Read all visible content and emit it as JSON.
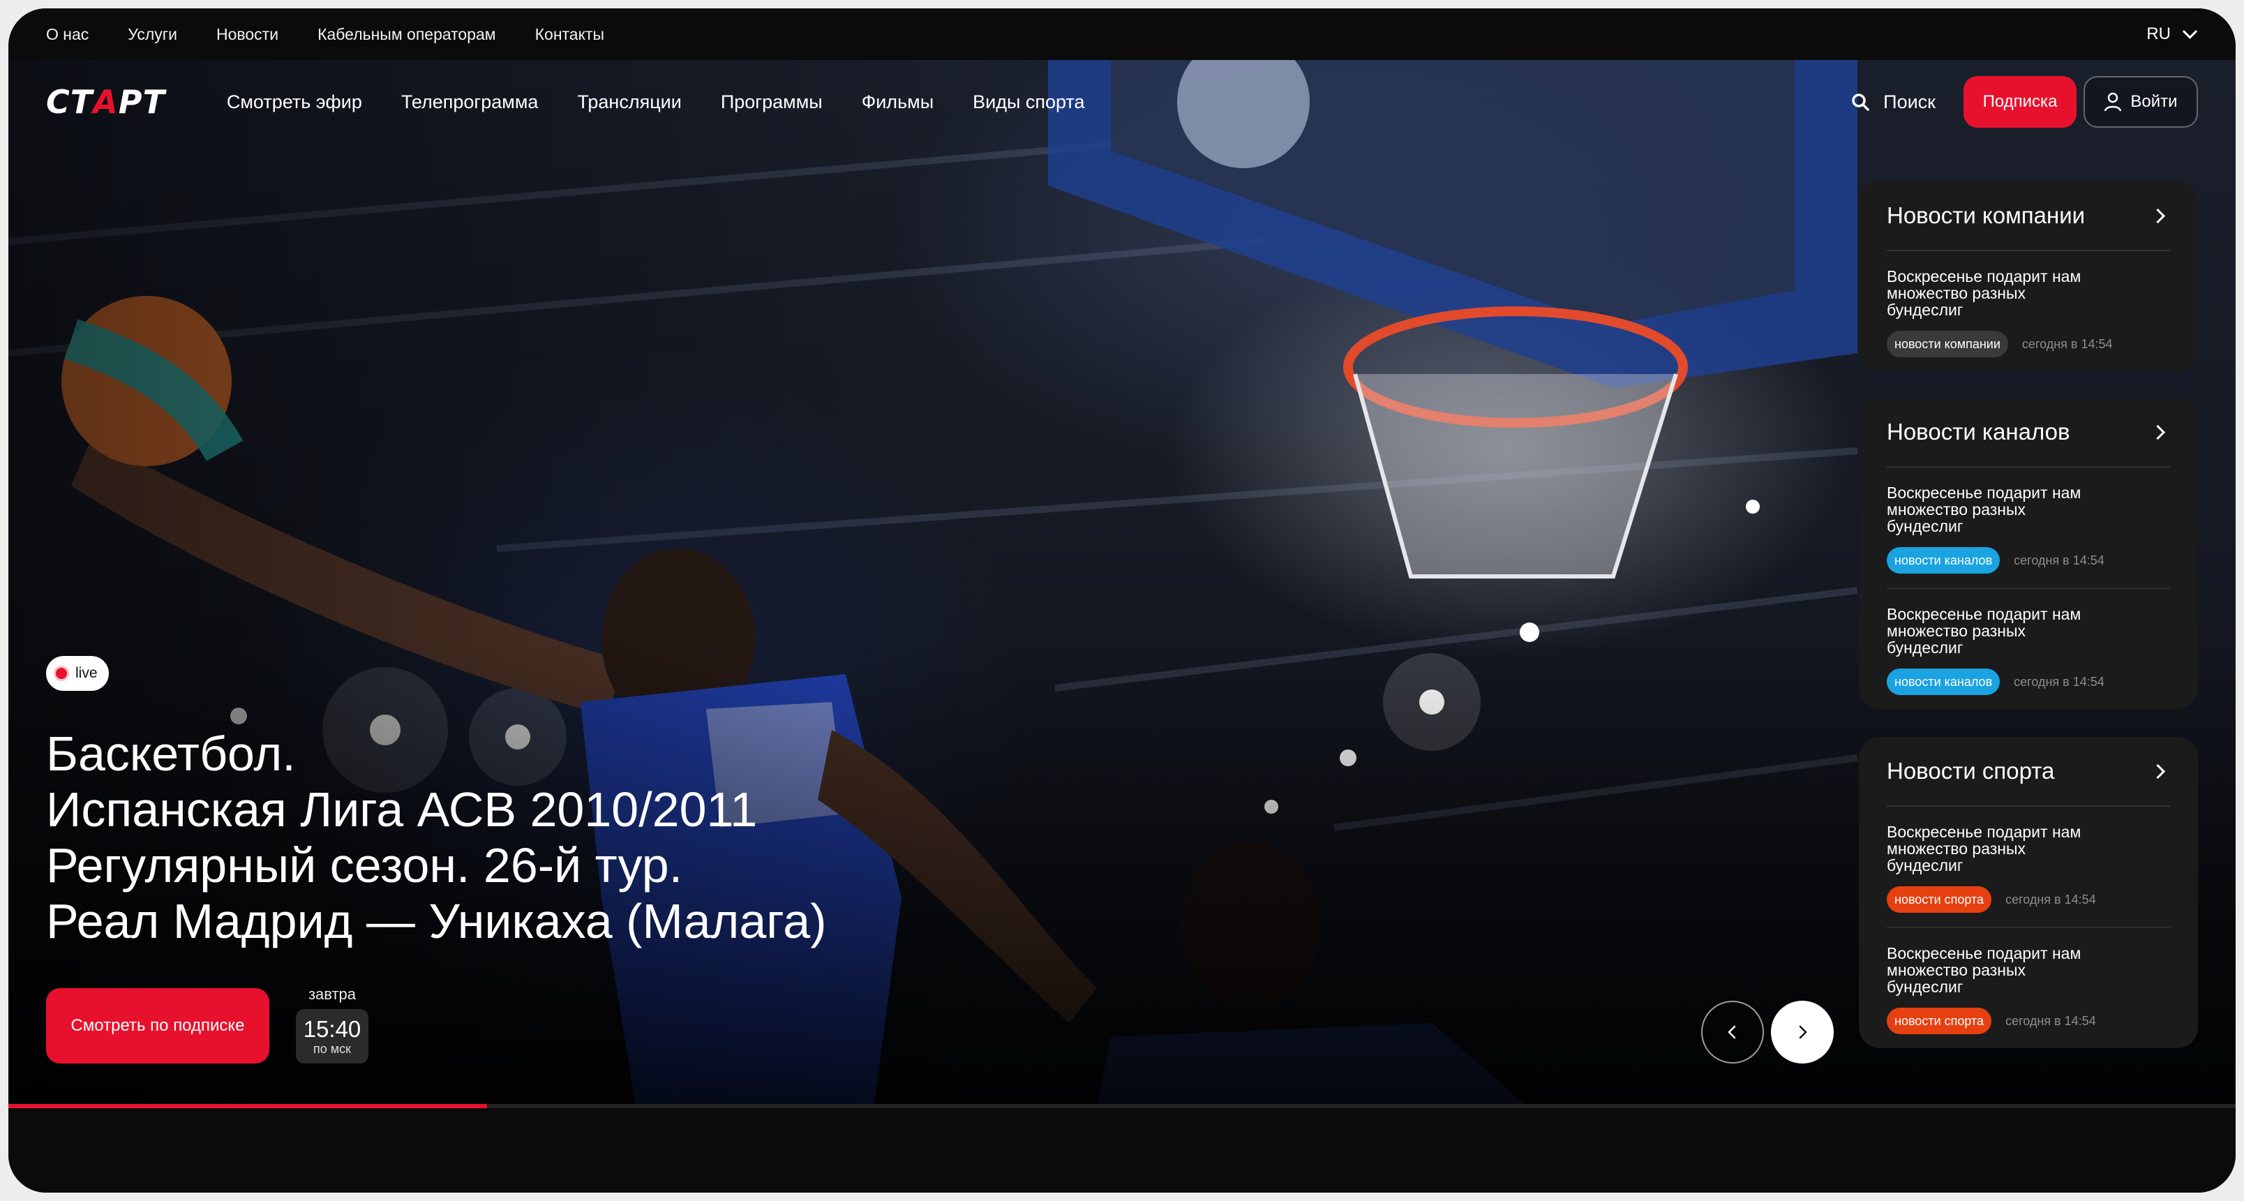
{
  "topbar": {
    "links": [
      "О нас",
      "Услуги",
      "Новости",
      "Кабельным операторам",
      "Контакты"
    ],
    "lang": "RU"
  },
  "nav": {
    "logo_pre": "СТ",
    "logo_accent": "А",
    "logo_post": "РТ",
    "menu": [
      "Смотреть эфир",
      "Телепрограмма",
      "Трансляции",
      "Программы",
      "Фильмы",
      "Виды спорта"
    ],
    "search_label": "Поиск",
    "subscribe_label": "Подписка",
    "login_label": "Войти"
  },
  "hero": {
    "live_label": "live",
    "title_lines": [
      "Баскетбол.",
      "Испанская Лига АСВ 2010/2011",
      "Регулярный сезон. 26-й тур.",
      "Реал Мадрид — Уникаха (Малага)"
    ],
    "watch_label": "Смотреть по подписке",
    "day": "завтра",
    "time": "15:40",
    "timezone": "по мск",
    "progress": 0.215
  },
  "panels": [
    {
      "title": "Новости компании",
      "items": [
        {
          "text": "Воскресенье подарит нам множество разных бундеслиг",
          "tag": "новости компании",
          "tag_kind": "company",
          "time": "сегодня в 14:54"
        }
      ]
    },
    {
      "title": "Новости каналов",
      "items": [
        {
          "text": "Воскресенье подарит нам множество разных бундеслиг",
          "tag": "новости каналов",
          "tag_kind": "channels",
          "time": "сегодня в 14:54"
        },
        {
          "text": "Воскресенье подарит нам множество разных бундеслиг",
          "tag": "новости каналов",
          "tag_kind": "channels",
          "time": "сегодня в 14:54"
        }
      ]
    },
    {
      "title": "Новости спорта",
      "items": [
        {
          "text": "Воскресенье подарит нам множество разных бундеслиг",
          "tag": "новости спорта",
          "tag_kind": "sport",
          "time": "сегодня в 14:54"
        },
        {
          "text": "Воскресенье подарит нам множество разных бундеслиг",
          "tag": "новости спорта",
          "tag_kind": "sport",
          "time": "сегодня в 14:54"
        }
      ]
    }
  ],
  "colors": {
    "accent": "#e8112d",
    "tag_company": "#3a3a3a",
    "tag_channels": "#1aa3e0",
    "tag_sport": "#e64010",
    "panel_bg": "#1b1b1b"
  }
}
